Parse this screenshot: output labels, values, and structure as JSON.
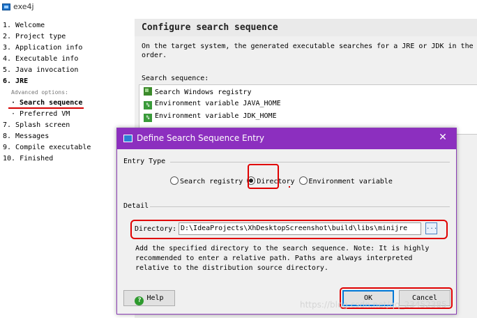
{
  "window": {
    "title": "exe4j",
    "icon": "app-icon"
  },
  "steps": [
    "1. Welcome",
    "2. Project type",
    "3. Application info",
    "4. Executable info",
    "5. Java invocation",
    "6. JRE",
    "Advanced options:",
    "· Search sequence",
    "· Preferred VM",
    "7. Splash screen",
    "8. Messages",
    "9. Compile executable",
    "10. Finished"
  ],
  "panel": {
    "title": "Configure search sequence",
    "description_line1": "On the target system, the generated executable searches for a JRE or JDK in the f",
    "description_line2": "order.",
    "sequence_label": "Search sequence:",
    "sequence_items": [
      {
        "icon": "registry-icon",
        "label": "Search Windows registry"
      },
      {
        "icon": "environment-variable-icon",
        "label": "Environment variable JAVA_HOME"
      },
      {
        "icon": "environment-variable-icon",
        "label": "Environment variable JDK_HOME"
      }
    ]
  },
  "dialog": {
    "title": "Define Search Sequence Entry",
    "close_icon": "close-icon",
    "entry_type_label": "Entry Type",
    "options": [
      {
        "label": "Search registry",
        "selected": false
      },
      {
        "label": "Directory",
        "selected": true
      },
      {
        "label": "Environment variable",
        "selected": false
      }
    ],
    "detail_label": "Detail",
    "directory_label": "Directory:",
    "directory_value": "D:\\IdeaProjects\\XhDesktopScreenshot\\build\\libs\\minijre",
    "browse_label": "...",
    "help_lines": [
      "Add the specified directory to the search sequence. Note: It is highly",
      "recommended to enter a relative path. Paths are always interpreted",
      "relative to the distribution source directory."
    ],
    "help_button": "Help",
    "ok_button": "OK",
    "cancel_button": "Cancel"
  },
  "watermark": "https://blog.csdn.net/qq_23452385",
  "colors": {
    "dialog_titlebar": "#8c2fbf",
    "highlight": "#e00000"
  }
}
